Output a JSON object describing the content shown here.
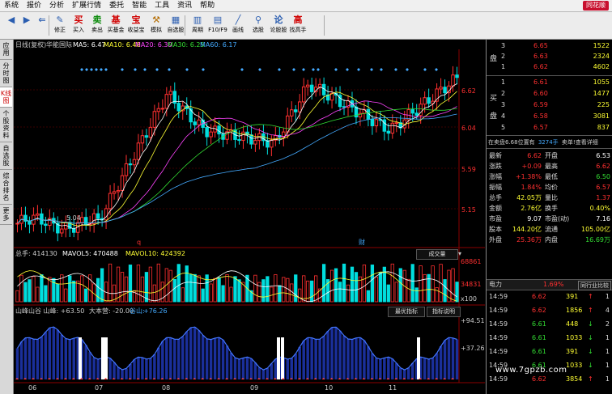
{
  "menu": {
    "items": [
      "系统",
      "报价",
      "分析",
      "扩展行情",
      "委托",
      "智能",
      "工具",
      "资讯",
      "帮助"
    ],
    "brand": "同花顺"
  },
  "toolbar": {
    "buttons": [
      {
        "label": "",
        "icon": "◀",
        "color": "#2a5db0",
        "name": "back-icon"
      },
      {
        "label": "",
        "icon": "▶",
        "color": "#2a5db0",
        "name": "forward-icon"
      },
      {
        "label": "",
        "icon": "⇐",
        "color": "#2a5db0",
        "name": "home-icon"
      },
      {
        "label": "修正",
        "icon": "✎",
        "color": "#2a5db0",
        "name": "modify-icon"
      },
      {
        "label": "买入",
        "icon": "买",
        "color": "#d00000",
        "name": "buy-icon"
      },
      {
        "label": "卖出",
        "icon": "卖",
        "color": "#0a8a0a",
        "name": "sell-icon"
      },
      {
        "label": "买基金",
        "icon": "基",
        "color": "#d00000",
        "name": "fund-icon"
      },
      {
        "label": "收益宝",
        "icon": "宝",
        "color": "#d00000",
        "name": "yield-icon"
      },
      {
        "label": "模拟",
        "icon": "⚒",
        "color": "#b36b00",
        "name": "simulate-icon"
      },
      {
        "label": "自选股",
        "icon": "▦",
        "color": "#2a5db0",
        "name": "watchlist-icon"
      },
      {
        "label": "周期",
        "icon": "▥",
        "color": "#2a5db0",
        "name": "period-icon"
      },
      {
        "label": "F10/F9",
        "icon": "▤",
        "color": "#2a5db0",
        "name": "f10-icon"
      },
      {
        "label": "画线",
        "icon": "╱",
        "color": "#2a5db0",
        "name": "draw-icon"
      },
      {
        "label": "选股",
        "icon": "⚲",
        "color": "#2a5db0",
        "name": "select-stock-icon"
      },
      {
        "label": "论股股",
        "icon": "论",
        "color": "#2a5db0",
        "name": "forum-icon"
      },
      {
        "label": "找高手",
        "icon": "高",
        "color": "#d00000",
        "name": "expert-icon"
      }
    ]
  },
  "sidebar": {
    "tabs": [
      "应用",
      "分时图",
      "K线图",
      "个股资料",
      "自选股",
      "综合排名",
      "更多"
    ]
  },
  "kline": {
    "title": "日线(复权)",
    "stock": "华能国际",
    "ma5": "MA5: 6.47",
    "ma10": "MA10: 6.48",
    "ma20": "MA20: 6.30",
    "ma30": "MA30: 6.25",
    "ma60": "MA60: 6.17",
    "axis": [
      "6.62",
      "6.04",
      "5.59",
      "5.15"
    ],
    "low_label": "5.04",
    "mark_q": "q",
    "mark_cai": "财"
  },
  "volume": {
    "header": "总手: 414130",
    "mavol5": "MAVOL5: 470488",
    "mavol10": "MAVOL10: 424392",
    "button": "成交量",
    "axis": [
      "68861",
      "34831",
      "x100"
    ]
  },
  "indicator": {
    "header": "山峰山谷 山峰: +63.50",
    "big": "大本营: -20.00",
    "sub1": "谷山: ",
    "sub2": "+76.26",
    "btn1": "最优指标",
    "btn2": "指标说明",
    "axis": [
      "+94.51",
      "+37.26"
    ]
  },
  "xaxis": [
    "06",
    "07",
    "08",
    "09",
    "10",
    "11"
  ],
  "orderbook": {
    "sell_label": "盘",
    "buy_label": "买盘",
    "sell": [
      {
        "lv": "3",
        "price": "6.65",
        "vol": "1522"
      },
      {
        "lv": "2",
        "price": "6.63",
        "vol": "2324"
      },
      {
        "lv": "1",
        "price": "6.62",
        "vol": "4602"
      }
    ],
    "buy": [
      {
        "lv": "1",
        "price": "6.61",
        "vol": "1055"
      },
      {
        "lv": "2",
        "price": "6.60",
        "vol": "1477"
      },
      {
        "lv": "3",
        "price": "6.59",
        "vol": "225"
      },
      {
        "lv": "4",
        "price": "6.58",
        "vol": "3081"
      },
      {
        "lv": "5",
        "price": "6.57",
        "vol": "837"
      }
    ]
  },
  "status": {
    "left": "在卖盘6.68位置有",
    "mid": "3274手",
    "right": "卖单!查看详细"
  },
  "stats": [
    {
      "k1": "最新",
      "v1": "6.62",
      "k2": "开盘",
      "v2": "6.53",
      "c1": "#ff3030",
      "c2": "#ffffff"
    },
    {
      "k1": "涨跌",
      "v1": "+0.09",
      "k2": "最高",
      "v2": "6.62",
      "c1": "#ff3030",
      "c2": "#ff3030"
    },
    {
      "k1": "涨幅",
      "v1": "+1.38%",
      "k2": "最低",
      "v2": "6.50",
      "c1": "#ff3030",
      "c2": "#33dd33"
    },
    {
      "k1": "振幅",
      "v1": "1.84%",
      "k2": "均价",
      "v2": "6.57",
      "c1": "#ff3030",
      "c2": "#ff3030"
    },
    {
      "k1": "总手",
      "v1": "42.05万",
      "k2": "量比",
      "v2": "1.37",
      "c1": "#ffff33",
      "c2": "#ff3030"
    },
    {
      "k1": "金额",
      "v1": "2.76亿",
      "k2": "换手",
      "v2": "0.40%",
      "c1": "#ffff33",
      "c2": "#ffff33"
    },
    {
      "k1": "市盈",
      "v1": "9.07",
      "k2": "市盈(动)",
      "v2": "7.16",
      "c1": "#ffffff",
      "c2": "#ffffff"
    },
    {
      "k1": "股本",
      "v1": "144.20亿",
      "k2": "流通",
      "v2": "105.00亿",
      "c1": "#ffff33",
      "c2": "#ffff33"
    },
    {
      "k1": "外盘",
      "v1": "25.36万",
      "k2": "内盘",
      "v2": "16.69万",
      "c1": "#ff3030",
      "c2": "#33dd33"
    }
  ],
  "industry": {
    "label": "电力",
    "pct": "1.69%",
    "btn": "同行业比较"
  },
  "ticks": [
    {
      "time": "14:59",
      "price": "6.62",
      "vol": "391",
      "dir": "↑",
      "bs": "1",
      "c": "#ff3030"
    },
    {
      "time": "14:59",
      "price": "6.62",
      "vol": "1856",
      "dir": "↑",
      "bs": "4",
      "c": "#ff3030"
    },
    {
      "time": "14:59",
      "price": "6.61",
      "vol": "448",
      "dir": "↓",
      "bs": "2",
      "c": "#33dd33"
    },
    {
      "time": "14:59",
      "price": "6.61",
      "vol": "1033",
      "dir": "↓",
      "bs": "1",
      "c": "#33dd33"
    },
    {
      "time": "14:59",
      "price": "6.61",
      "vol": "391",
      "dir": "↓",
      "bs": "1",
      "c": "#33dd33"
    },
    {
      "time": "14:59",
      "price": "6.61",
      "vol": "1033",
      "dir": "↓",
      "bs": "1",
      "c": "#33dd33"
    },
    {
      "time": "14:59",
      "price": "6.62",
      "vol": "3854",
      "dir": "↑",
      "bs": "1",
      "c": "#ff3030"
    }
  ],
  "watermark": "www.7gpzb.com"
}
